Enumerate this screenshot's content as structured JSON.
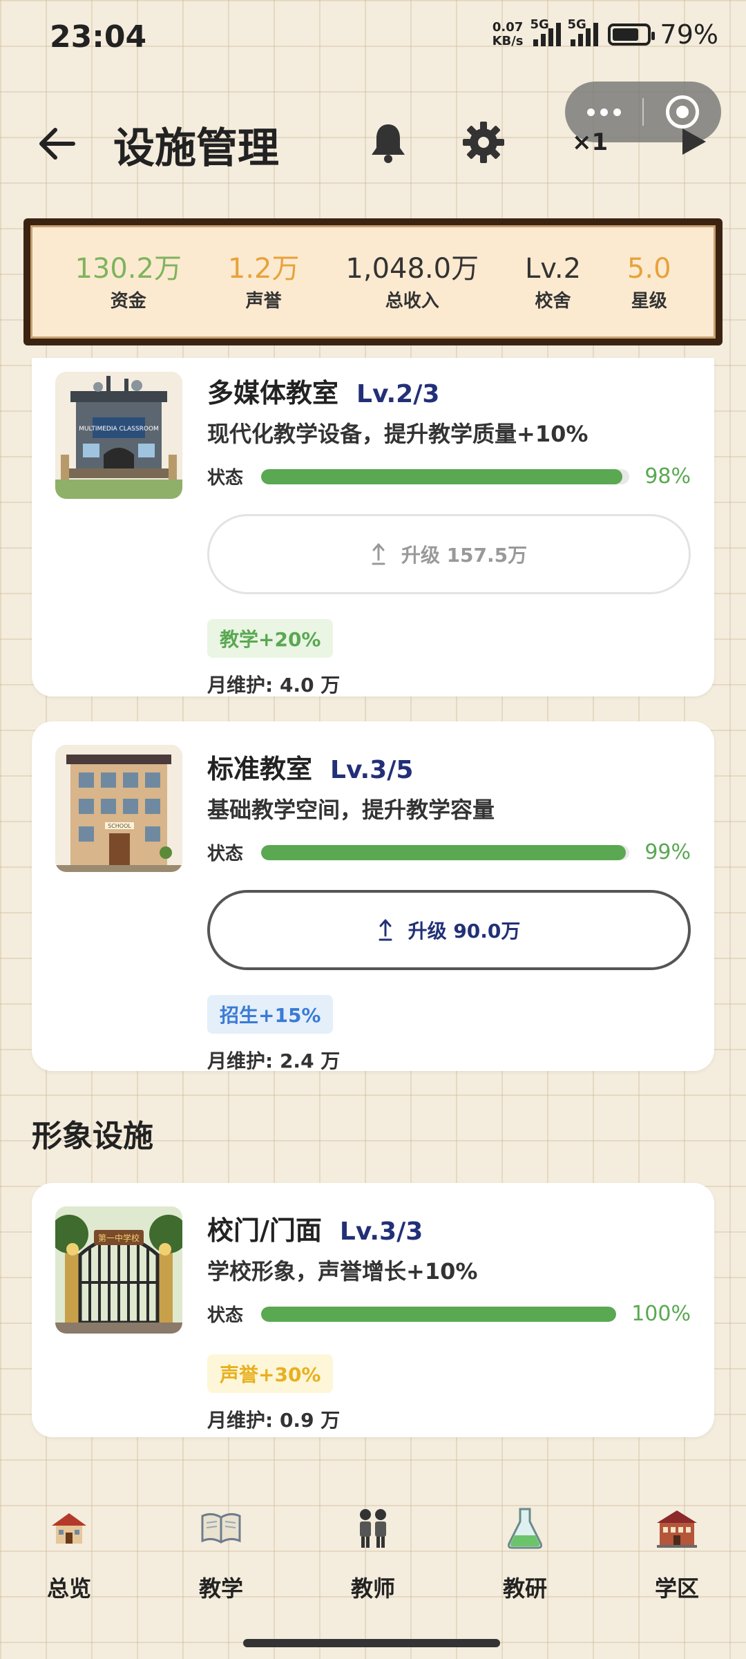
{
  "status_bar": {
    "time": "23:04",
    "net_speed_value": "0.07",
    "net_speed_unit": "KB/s",
    "signal1_label": "5G",
    "signal2_label": "5G",
    "battery": "79%"
  },
  "header": {
    "title": "设施管理",
    "speed": "×1"
  },
  "stats": [
    {
      "value": "130.2万",
      "label": "资金",
      "color": "#7fb35d"
    },
    {
      "value": "1.2万",
      "label": "声誉",
      "color": "#e8a23a"
    },
    {
      "value": "1,048.0万",
      "label": "总收入",
      "color": "#333333"
    },
    {
      "value": "Lv.2",
      "label": "校舍",
      "color": "#333333"
    },
    {
      "value": "5.0",
      "label": "星级",
      "color": "#e8a23a"
    }
  ],
  "cards": [
    {
      "name": "多媒体教室",
      "level": "Lv.2/3",
      "desc": "现代化教学设备，提升教学质量+10%",
      "status_label": "状态",
      "status_pct": "98%",
      "status_value": 0.98,
      "upgrade": "升级 157.5万",
      "upgrade_enabled": false,
      "tag": "教学+20%",
      "tag_color": "#5aa852",
      "tag_bg": "#eaf5e4",
      "maintenance": "月维护: 4.0 万",
      "image_caption": "MULTIMEDIA CLASSROOM"
    },
    {
      "name": "标准教室",
      "level": "Lv.3/5",
      "desc": "基础教学空间，提升教学容量",
      "status_label": "状态",
      "status_pct": "99%",
      "status_value": 0.99,
      "upgrade": "升级 90.0万",
      "upgrade_enabled": true,
      "tag": "招生+15%",
      "tag_color": "#3a7bd5",
      "tag_bg": "#e4effa",
      "maintenance": "月维护: 2.4 万",
      "image_caption": "SCHOOL"
    }
  ],
  "section": {
    "title": "形象设施"
  },
  "gate_card": {
    "name": "校门/门面",
    "level": "Lv.3/3",
    "desc": "学校形象，声誉增长+10%",
    "status_label": "状态",
    "status_pct": "100%",
    "status_value": 1.0,
    "tag": "声誉+30%",
    "tag_color": "#e8b020",
    "tag_bg": "#fdf6d8",
    "maintenance": "月维护: 0.9 万",
    "image_caption": "第一中学校"
  },
  "nav": [
    {
      "label": "总览",
      "icon": "school-house-icon"
    },
    {
      "label": "教学",
      "icon": "open-book-icon"
    },
    {
      "label": "教师",
      "icon": "teachers-icon"
    },
    {
      "label": "教研",
      "icon": "flask-icon"
    },
    {
      "label": "学区",
      "icon": "school-building-icon"
    }
  ],
  "colors": {
    "accent_green": "#5aa852",
    "level_blue": "#223077",
    "panel_brown": "#3b2312"
  }
}
